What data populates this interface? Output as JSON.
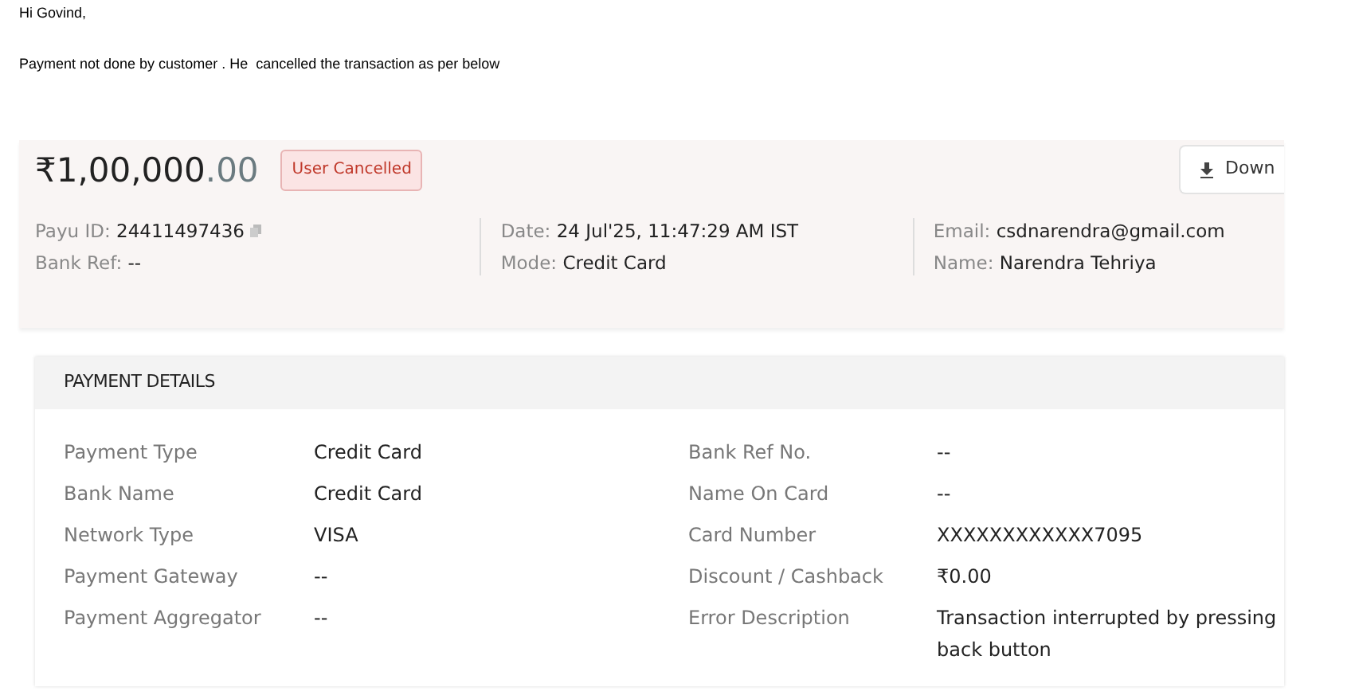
{
  "email": {
    "greeting": "Hi Govind,",
    "message": "Payment not done by customer . He  cancelled the transaction as per below"
  },
  "summary": {
    "amount": "₹1,00,000",
    "amount_decimal": ".00",
    "status": "User Cancelled",
    "download_button": "Down",
    "info_columns": [
      [
        {
          "label": "Payu ID:",
          "value": "24411497436",
          "copy": true
        },
        {
          "label": "Bank Ref:",
          "value": "--",
          "copy": false
        }
      ],
      [
        {
          "label": "Date:",
          "value": "24 Jul'25, 11:47:29 AM IST",
          "copy": false
        },
        {
          "label": "Mode:",
          "value": "Credit Card",
          "copy": false
        }
      ],
      [
        {
          "label": "Email:",
          "value": "csdnarendra@gmail.com",
          "copy": false
        },
        {
          "label": "Name:",
          "value": "Narendra Tehriya",
          "copy": false
        }
      ]
    ]
  },
  "payment_details": {
    "title": "PAYMENT DETAILS",
    "left": [
      {
        "label": "Payment Type",
        "value": "Credit Card"
      },
      {
        "label": "Bank Name",
        "value": "Credit Card"
      },
      {
        "label": "Network Type",
        "value": "VISA"
      },
      {
        "label": "Payment Gateway",
        "value": "--"
      },
      {
        "label": "Payment Aggregator",
        "value": "--"
      }
    ],
    "right": [
      {
        "label": "Bank Ref No.",
        "value": "--"
      },
      {
        "label": "Name On Card",
        "value": "--"
      },
      {
        "label": "Card Number",
        "value": "XXXXXXXXXXXX7095"
      },
      {
        "label": "Discount / Cashback",
        "value": "₹0.00"
      },
      {
        "label": "Error Description",
        "value": "Transaction interrupted by pressing back button"
      }
    ]
  }
}
